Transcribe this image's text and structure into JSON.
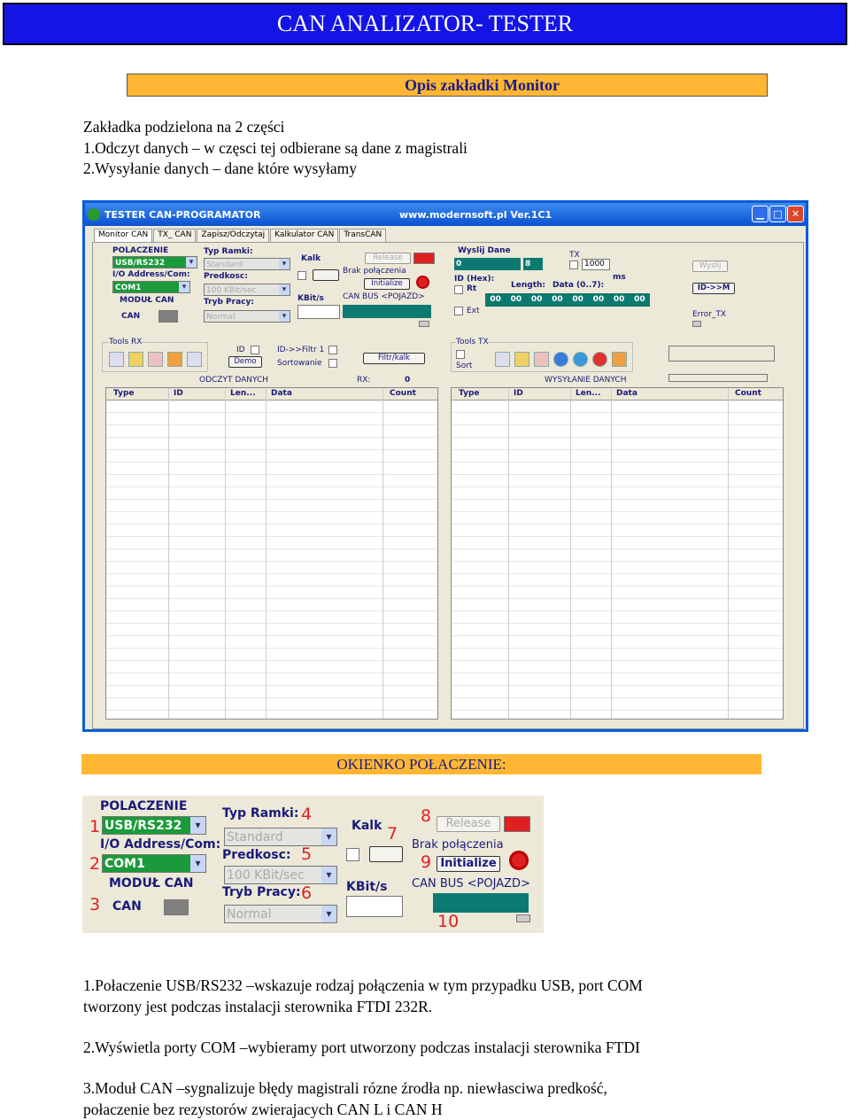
{
  "header": {
    "title": "CAN ANALIZATOR- TESTER"
  },
  "section_bar": {
    "label": "Opis zakładki Monitor"
  },
  "intro": {
    "lines": [
      "Zakładka podzielona na 2 części",
      "1.Odczyt danych – w częsci tej odbierane są dane z magistrali",
      "2.Wysyłanie danych – dane które wysyłamy"
    ]
  },
  "app": {
    "title": "TESTER CAN-PROGRAMATOR",
    "url": "www.modernsoft.pl   Ver.1C1",
    "tabs": [
      "Monitor CAN",
      "TX_ CAN",
      "Zapisz/Odczytaj",
      "Kalkulator CAN",
      "TransCAN"
    ],
    "polaczenie": "POLACZENIE",
    "usb": "USB/RS232",
    "io_address": "I/O Address/Com:",
    "com1": "COM1",
    "modul_can": "MODUŁ CAN",
    "can": "CAN",
    "typ_ramki": "Typ Ramki:",
    "standard": "Standard",
    "predkosc": "Predkosc:",
    "kbit": "100 KBit/sec",
    "tryb_pracy": "Tryb Pracy:",
    "normal": "Normal",
    "kalk": "Kalk",
    "kbits": "KBit/s",
    "release": "Release",
    "brak": "Brak połączenia",
    "initialize": "Initialize",
    "can_bus": "CAN BUS <POJAZD>",
    "wyslij_dane": "Wyslij Dane",
    "tx": "TX",
    "ms_value": "1000",
    "ms": "ms",
    "id_val": "0",
    "len_val": "8",
    "id_hex": "ID (Hex):",
    "rt": "Rt",
    "length": "Length:",
    "data_range": "Data (0..7):",
    "ext": "Ext",
    "data_bytes": [
      "00",
      "00",
      "00",
      "00",
      "00",
      "00",
      "00",
      "00"
    ],
    "wyslij_btn": "Wyslij",
    "id_m": "ID->>M",
    "error_tx": "Error_TX",
    "tools_rx": "Tools RX",
    "id": "ID",
    "demo": "Demo",
    "filtr": "ID->>Filtr 1",
    "sortowanie": "Sortowanie",
    "filtr_kalk": "Filtr/kalk",
    "tools_tx": "Tools TX",
    "sort": "Sort",
    "odczyt": "ODCZYT DANYCH",
    "rx": "RX:",
    "rx_count": "0",
    "wysylanie": "WYSYŁANIE DANYCH",
    "columns": [
      "Type",
      "ID",
      "Len...",
      "Data",
      "Count"
    ]
  },
  "okienko_bar": {
    "label": "OKIENKO POŁACZENIE:"
  },
  "zoom_numbers": [
    "1",
    "2",
    "3",
    "4",
    "5",
    "6",
    "7",
    "8",
    "9",
    "10"
  ],
  "paragraphs": [
    {
      "lines": [
        "1.Połaczenie USB/RS232 –wskazuje rodzaj połączenia w tym przypadku USB, port COM",
        "tworzony jest podczas instalacji sterownika FTDI 232R."
      ]
    },
    {
      "lines": [
        "2.Wyświetla porty COM –wybieramy port utworzony podczas instalacji sterownika FTDI"
      ]
    },
    {
      "lines": [
        "3.Moduł CAN –sygnalizuje błędy magistrali rózne źrodła np. niewłasciwa predkość,",
        "połaczenie bez rezystorów zwierajacych CAN L i CAN H"
      ]
    }
  ],
  "colors": {
    "title_bg": "#1414e6",
    "orange": "#ffb733",
    "green": "#1a9a3a",
    "teal": "#0d7a72",
    "red": "#e02020"
  }
}
